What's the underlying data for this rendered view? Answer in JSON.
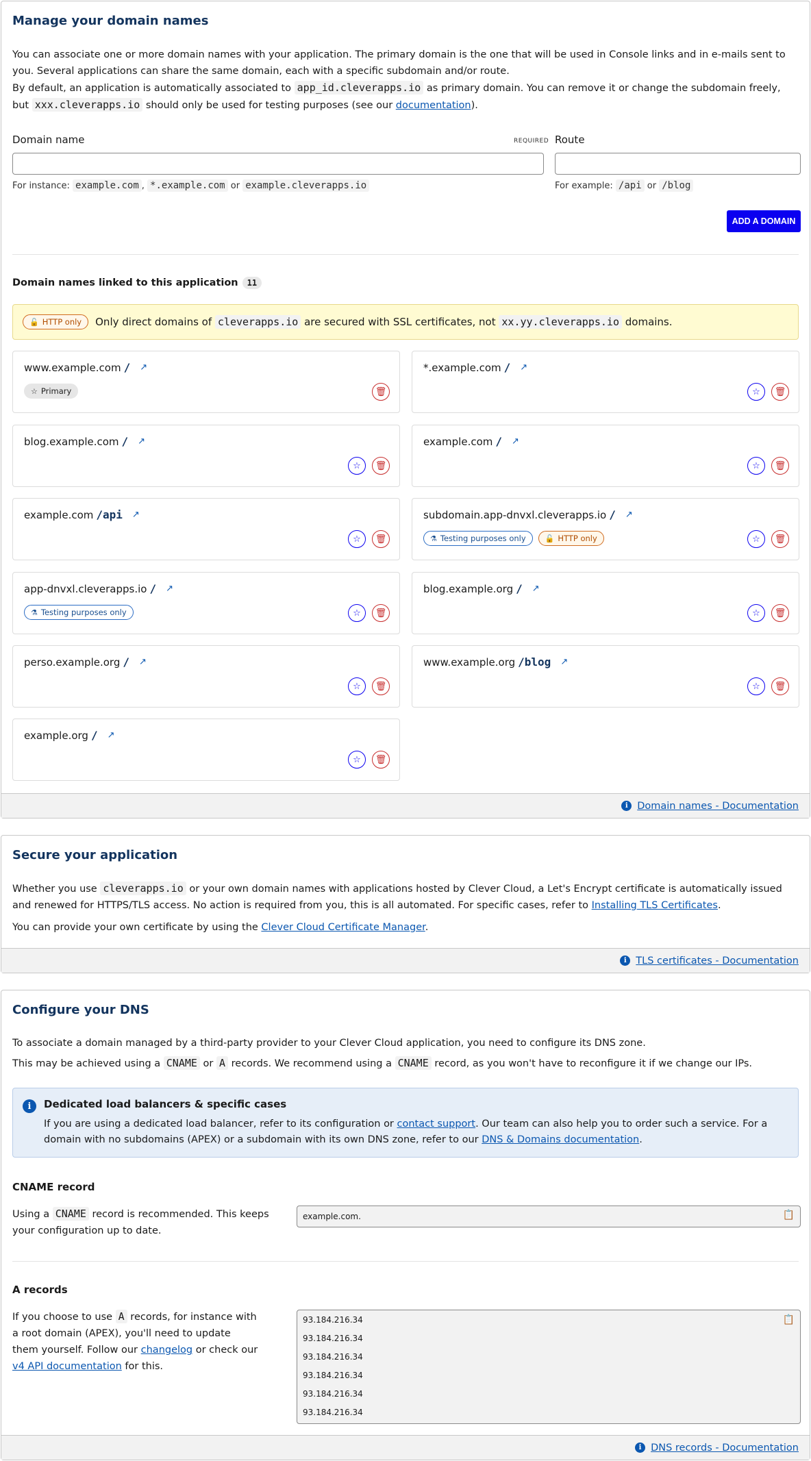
{
  "domains_section": {
    "title": "Manage your domain names",
    "intro1": "You can associate one or more domain names with your application. The primary domain is the one that will be used in Console links and in e-mails sent to you. Several applications can share the same domain, each with a specific subdomain and/or route.",
    "intro2_a": "By default, an application is automatically associated to ",
    "intro2_code1": "app_id.cleverapps.io",
    "intro2_b": " as primary domain. You can remove it or change the subdomain freely, but ",
    "intro2_code2": "xxx.cleverapps.io",
    "intro2_c": " should only be used for testing purposes (see our ",
    "intro2_link": "documentation",
    "intro2_d": ").",
    "domain_label": "Domain name",
    "required_label": "REQUIRED",
    "route_label": "Route",
    "domain_value": "",
    "route_value": "",
    "domain_hint_prefix": "For instance:",
    "domain_hint_code1": "example.com",
    "domain_hint_code2": "*.example.com",
    "domain_hint_or": "or",
    "domain_hint_code3": "example.cleverapps.io",
    "route_hint_prefix": "For example:",
    "route_hint_code1": "/api",
    "route_hint_or": "or",
    "route_hint_code2": "/blog",
    "add_button": "ADD A DOMAIN",
    "linked_title": "Domain names linked to this application",
    "linked_count": "11",
    "warning_badge": "HTTP only",
    "warning_a": "Only direct domains of ",
    "warning_code1": "cleverapps.io",
    "warning_b": " are secured with SSL certificates, not ",
    "warning_code2": "xx.yy.cleverapps.io",
    "warning_c": " domains.",
    "domains": [
      {
        "host": "www.example.com",
        "route": "/",
        "primary": true,
        "tags": []
      },
      {
        "host": "*.example.com",
        "route": "/",
        "primary": false,
        "tags": []
      },
      {
        "host": "blog.example.com",
        "route": "/",
        "primary": false,
        "tags": []
      },
      {
        "host": "example.com",
        "route": "/",
        "primary": false,
        "tags": []
      },
      {
        "host": "example.com",
        "route": "/api",
        "primary": false,
        "tags": []
      },
      {
        "host": "subdomain.app-dnvxl.cleverapps.io",
        "route": "/",
        "primary": false,
        "tags": [
          "test",
          "http"
        ]
      },
      {
        "host": "app-dnvxl.cleverapps.io",
        "route": "/",
        "primary": false,
        "tags": [
          "test"
        ]
      },
      {
        "host": "blog.example.org",
        "route": "/",
        "primary": false,
        "tags": []
      },
      {
        "host": "perso.example.org",
        "route": "/",
        "primary": false,
        "tags": []
      },
      {
        "host": "www.example.org",
        "route": "/blog",
        "primary": false,
        "tags": []
      },
      {
        "host": "example.org",
        "route": "/",
        "primary": false,
        "tags": []
      }
    ],
    "primary_label": "Primary",
    "test_label": "Testing purposes only",
    "http_label": "HTTP only",
    "footer_link": "Domain names - Documentation"
  },
  "tls_section": {
    "title": "Secure your application",
    "p1_a": "Whether you use ",
    "p1_code": "cleverapps.io",
    "p1_b": " or your own domain names with applications hosted by Clever Cloud, a Let's Encrypt certificate is automatically issued and renewed for HTTPS/TLS access. No action is required from you, this is all automated. For specific cases, refer to ",
    "p1_link": "Installing TLS Certificates",
    "p1_c": ".",
    "p2_a": "You can provide your own certificate by using the ",
    "p2_link": "Clever Cloud Certificate Manager",
    "p2_b": ".",
    "footer_link": "TLS certificates - Documentation"
  },
  "dns_section": {
    "title": "Configure your DNS",
    "p1": "To associate a domain managed by a third-party provider to your Clever Cloud application, you need to configure its DNS zone.",
    "p2_a": "This may be achieved using a ",
    "p2_code1": "CNAME",
    "p2_or": " or ",
    "p2_code2": "A",
    "p2_b": " records. We recommend using a ",
    "p2_code3": "CNAME",
    "p2_c": " record, as you won't have to reconfigure it if we change our IPs.",
    "note_title": "Dedicated load balancers & specific cases",
    "note_a": "If you are using a dedicated load balancer, refer to its configuration or ",
    "note_link1": "contact support",
    "note_b": ". Our team can also help you to order such a service. For a domain with no subdomains (APEX) or a subdomain with its own DNS zone, refer to our ",
    "note_link2": "DNS & Domains documentation",
    "note_c": ".",
    "cname_title": "CNAME record",
    "cname_a": "Using a ",
    "cname_code": "CNAME",
    "cname_b": " record is recommended. This keeps your configuration up to date.",
    "cname_value": "example.com.",
    "a_title": "A records",
    "a_a": "If you choose to use ",
    "a_code": "A",
    "a_b": " records, for instance with a root domain (APEX), you'll need to update them yourself. Follow our ",
    "a_link1": "changelog",
    "a_c": " or check our ",
    "a_link2": "v4 API documentation",
    "a_d": " for this.",
    "a_values": [
      "93.184.216.34",
      "93.184.216.34",
      "93.184.216.34",
      "93.184.216.34",
      "93.184.216.34",
      "93.184.216.34"
    ],
    "footer_link": "DNS records - Documentation"
  }
}
